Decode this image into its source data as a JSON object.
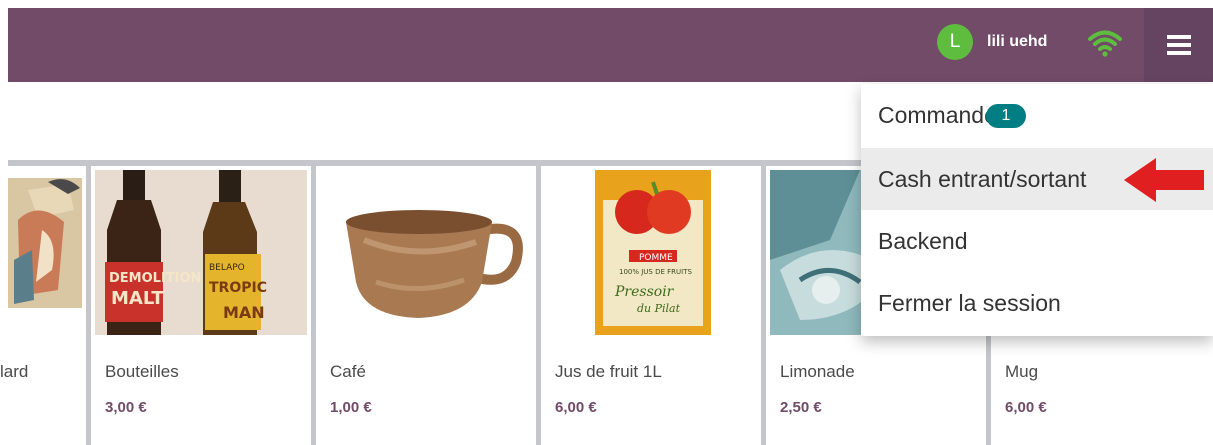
{
  "header": {
    "user_initial": "L",
    "user_name": "lili uehd",
    "icons": [
      "wifi-icon",
      "hamburger-menu-icon"
    ]
  },
  "products": [
    {
      "name": "lard",
      "price": "",
      "partial": true
    },
    {
      "name": "Bouteilles",
      "price": "3,00 €"
    },
    {
      "name": "Café",
      "price": "1,00 €"
    },
    {
      "name": "Jus de fruit 1L",
      "price": "6,00 €"
    },
    {
      "name": "Limonade",
      "price": "2,50 €"
    },
    {
      "name": "Mug",
      "price": "6,00 €"
    }
  ],
  "menu": {
    "items": [
      {
        "label": "Commandes",
        "badge": "1"
      },
      {
        "label": "Cash entrant/sortant"
      },
      {
        "label": "Backend"
      },
      {
        "label": "Fermer la session"
      }
    ]
  },
  "colors": {
    "header": "#714B67",
    "price": "#714B67",
    "badge": "#017E84",
    "avatar": "#5EBD3E",
    "wifi": "#5EBD3E",
    "annotation_arrow": "#E02020"
  }
}
